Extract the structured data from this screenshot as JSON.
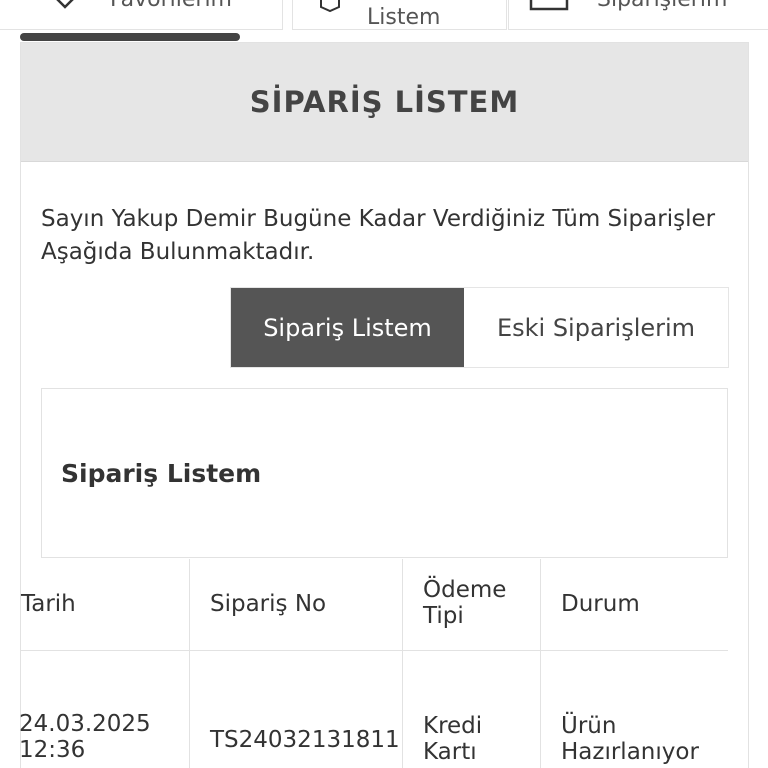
{
  "top_tabs": [
    {
      "label": "Favorilerim",
      "icon": "heart-icon"
    },
    {
      "label": "Listem",
      "icon": "box-icon"
    },
    {
      "label": "Siparişlerim",
      "icon": "bag-icon"
    }
  ],
  "header": {
    "title": "SİPARİŞ LİSTEM"
  },
  "greeting": "Sayın Yakup Demir Bugüne Kadar Verdiğiniz Tüm Siparişler Aşağıda Bulunmaktadır.",
  "toggle": {
    "active_label": "Sipariş Listem",
    "inactive_label": "Eski Siparişlerim"
  },
  "list_section": {
    "title": "Sipariş Listem"
  },
  "table": {
    "headers": [
      "Tarih",
      "Sipariş No",
      "Ödeme\nTipi",
      "Durum"
    ],
    "rows": [
      {
        "date": "24.03.2025\n12:36",
        "order_no": "TS24032131811",
        "payment": "Kredi\nKartı",
        "status": "Ürün\nHazırlanıyor"
      }
    ]
  },
  "colors": {
    "active_toggle": "#555555",
    "header_bg": "#e6e6e6",
    "scroll_indicator": "#444444"
  }
}
